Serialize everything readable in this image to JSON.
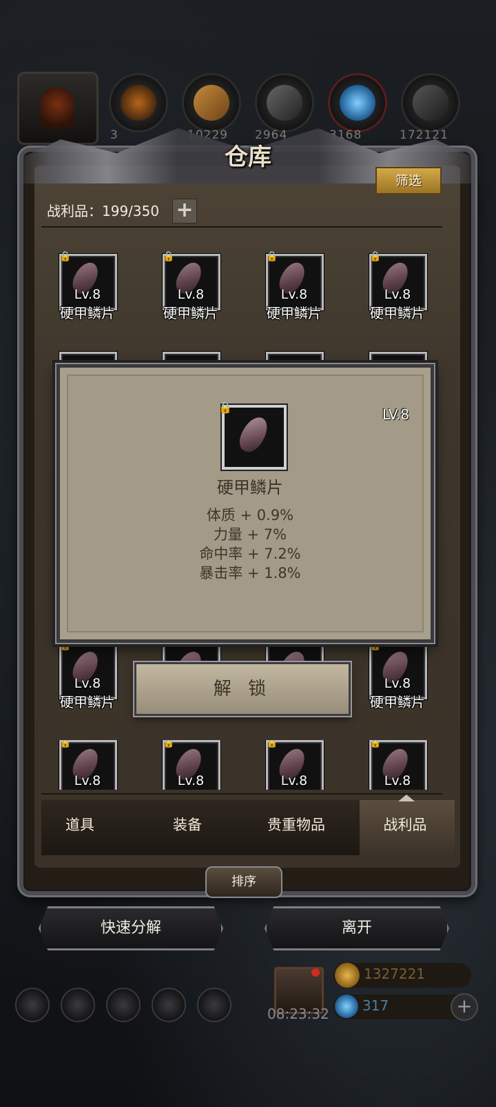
{
  "resources": {
    "counts": [
      "3",
      "10229",
      "2964",
      "3168",
      "172121"
    ]
  },
  "warehouse": {
    "title": "仓库",
    "filter_label": "筛选",
    "capacity_label": "战利品：199/350",
    "plus": "+"
  },
  "item": {
    "level": "Lv.8",
    "name": "硬甲鳞片"
  },
  "popup": {
    "level": "LV.8",
    "name": "硬甲鳞片",
    "stats": [
      "体质 + 0.9%",
      "力量 + 7%",
      "命中率 + 7.2%",
      "暴击率 + 1.8%"
    ],
    "unlock_label": "解 锁"
  },
  "tabs": [
    "道具",
    "装备",
    "贵重物品",
    "战利品"
  ],
  "active_tab": "战利品",
  "sort_label": "排序",
  "actions": {
    "quick_decompose": "快速分解",
    "leave": "离开"
  },
  "hud": {
    "timer": "08:23:32",
    "gold": "1327221",
    "gems": "317",
    "add": "+"
  },
  "colors": {
    "accent_gold": "#d4a94a",
    "panel_bg": "#3f372c",
    "popup_bg": "#a89f8c"
  }
}
